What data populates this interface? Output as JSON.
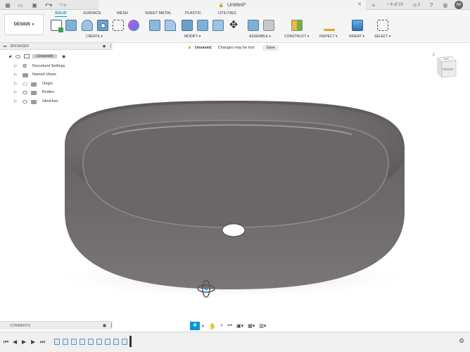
{
  "titlebar": {
    "doc_title": "Untitled*",
    "job_status": "6 of 10",
    "notifications": "1",
    "user_initials": "AB"
  },
  "ribbon": {
    "workspace": "DESIGN",
    "tabs": [
      "SOLID",
      "SURFACE",
      "MESH",
      "SHEET METAL",
      "PLASTIC",
      "UTILITIES"
    ],
    "active_tab": "SOLID",
    "groups": [
      "CREATE",
      "MODIFY",
      "ASSEMBLE",
      "CONSTRUCT",
      "INSPECT",
      "INSERT",
      "SELECT"
    ]
  },
  "browser": {
    "title": "BROWSER",
    "root": "(Unsaved)",
    "items": [
      {
        "label": "Document Settings",
        "icon": "gear-icon"
      },
      {
        "label": "Named Views",
        "icon": "folder-icon"
      },
      {
        "label": "Origin",
        "icon": "folder-icon"
      },
      {
        "label": "Bodies",
        "icon": "folder-icon"
      },
      {
        "label": "Sketches",
        "icon": "folder-icon"
      }
    ]
  },
  "unsaved_bar": {
    "label": "Unsaved:",
    "message": "Changes may be lost",
    "save_label": "Save"
  },
  "viewcube": {
    "top": "TOP",
    "front": "FRONT",
    "axis": "Z"
  },
  "comments": {
    "title": "COMMENTS"
  },
  "colors": {
    "accent": "#0696d7",
    "model": "#6e6a6c",
    "warning": "#e8a317"
  }
}
